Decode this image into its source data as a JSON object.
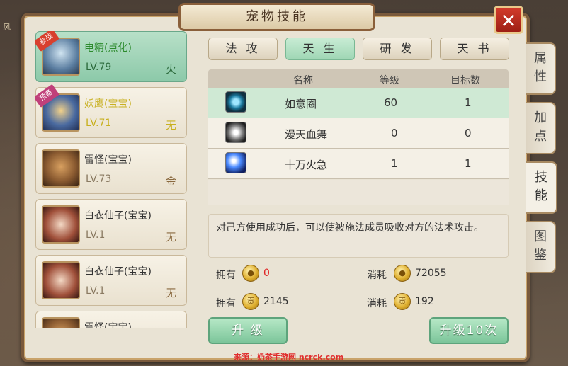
{
  "window": {
    "title": "宠物技能",
    "close_label": "✕"
  },
  "pets": [
    {
      "name": "电精(点化)",
      "level": "LV.79",
      "element": "火",
      "badge": "参战",
      "portrait": "blue-dragon-portrait",
      "selected": true,
      "style": "green"
    },
    {
      "name": "妖鹰(宝宝)",
      "level": "LV.71",
      "element": "无",
      "badge": "预备",
      "portrait": "tiger-beast-portrait",
      "selected": false,
      "style": "yellow"
    },
    {
      "name": "雷怪(宝宝)",
      "level": "LV.73",
      "element": "金",
      "badge": "",
      "portrait": "ogre-portrait",
      "selected": false,
      "style": "normal"
    },
    {
      "name": "白衣仙子(宝宝)",
      "level": "LV.1",
      "element": "无",
      "badge": "",
      "portrait": "fairy-portrait",
      "selected": false,
      "style": "normal"
    },
    {
      "name": "白衣仙子(宝宝)",
      "level": "LV.1",
      "element": "无",
      "badge": "",
      "portrait": "fairy-portrait",
      "selected": false,
      "style": "normal"
    },
    {
      "name": "雷怪(宝宝)",
      "level": "",
      "element": "",
      "badge": "",
      "portrait": "ogre-portrait",
      "selected": false,
      "style": "normal"
    }
  ],
  "tabs": [
    {
      "label": "法 攻",
      "active": false
    },
    {
      "label": "天 生",
      "active": true
    },
    {
      "label": "研 发",
      "active": false
    },
    {
      "label": "天 书",
      "active": false
    }
  ],
  "table": {
    "headers": [
      "名称",
      "等级",
      "目标数"
    ],
    "rows": [
      {
        "icon": "ring-icon",
        "name": "如意圈",
        "level": "60",
        "targets": "1",
        "selected": true
      },
      {
        "icon": "blood-wing-icon",
        "name": "漫天血舞",
        "level": "0",
        "targets": "0",
        "selected": false
      },
      {
        "icon": "fire-bolt-icon",
        "name": "十万火急",
        "level": "1",
        "targets": "1",
        "selected": false
      }
    ]
  },
  "description": "对己方使用成功后，可以使被施法成员吸收对方的法术攻击。",
  "resources": {
    "own_label": "拥有",
    "cost_label": "消耗",
    "coin_own": "0",
    "coin_cost": "72055",
    "gong_own": "2145",
    "gong_cost": "192",
    "coin_glyph": "●",
    "gong_glyph": "贡"
  },
  "buttons": {
    "upgrade": "升 级",
    "upgrade10": "升级10次"
  },
  "side_tabs": [
    {
      "label": "属性",
      "active": false
    },
    {
      "label": "加点",
      "active": false
    },
    {
      "label": "技能",
      "active": true
    },
    {
      "label": "图鉴",
      "active": false
    }
  ],
  "watermark": "来源：奶茶手游网 ncrck.com",
  "colors": {
    "accent_green": "#9fd6b4",
    "close_red": "#c0302a",
    "warning_red": "#e02020"
  }
}
